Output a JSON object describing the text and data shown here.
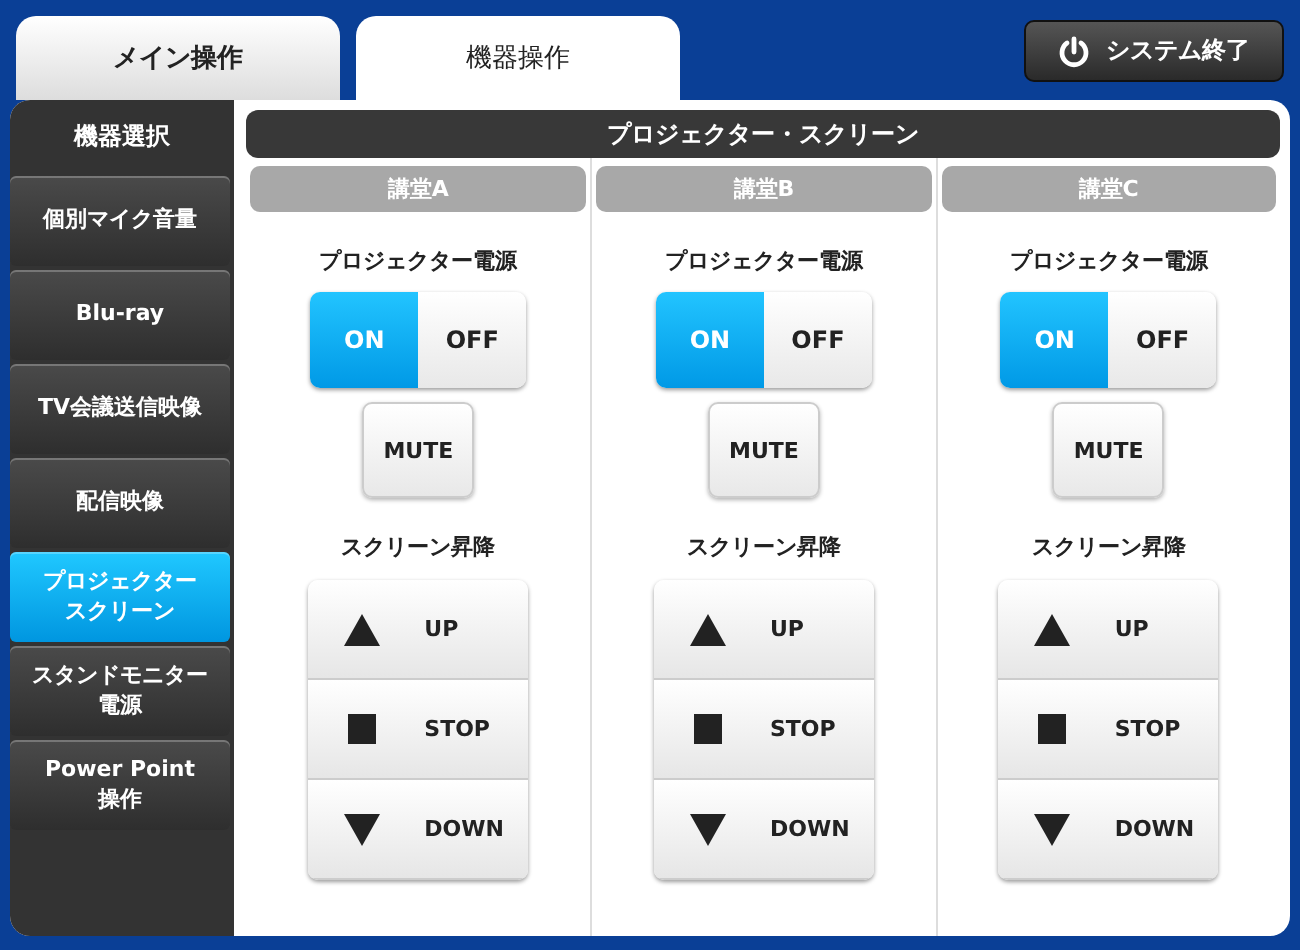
{
  "tabs": [
    {
      "label": "メイン操作",
      "selected": false
    },
    {
      "label": "機器操作",
      "selected": true
    }
  ],
  "system_button": {
    "label": "システム終了"
  },
  "sidebar": {
    "title": "機器選択",
    "items": [
      {
        "lines": [
          "個別マイク音量"
        ],
        "selected": false
      },
      {
        "lines": [
          "Blu-ray"
        ],
        "selected": false
      },
      {
        "lines": [
          "TV会議送信映像"
        ],
        "selected": false
      },
      {
        "lines": [
          "配信映像"
        ],
        "selected": false
      },
      {
        "lines": [
          "プロジェクター",
          "スクリーン"
        ],
        "selected": true
      },
      {
        "lines": [
          "スタンドモニター",
          "電源"
        ],
        "selected": false
      },
      {
        "lines": [
          "Power Point",
          "操作"
        ],
        "selected": false
      }
    ]
  },
  "panel": {
    "title": "プロジェクター・スクリーン",
    "rooms": [
      {
        "name": "講堂A",
        "power_label": "プロジェクター電源",
        "power": [
          {
            "label": "ON",
            "selected": true
          },
          {
            "label": "OFF",
            "selected": false
          }
        ],
        "mute": "MUTE",
        "screen_label": "スクリーン昇降",
        "screen": [
          {
            "kind": "up",
            "label": "UP"
          },
          {
            "kind": "stop",
            "label": "STOP"
          },
          {
            "kind": "down",
            "label": "DOWN"
          }
        ]
      },
      {
        "name": "講堂B",
        "power_label": "プロジェクター電源",
        "power": [
          {
            "label": "ON",
            "selected": true
          },
          {
            "label": "OFF",
            "selected": false
          }
        ],
        "mute": "MUTE",
        "screen_label": "スクリーン昇降",
        "screen": [
          {
            "kind": "up",
            "label": "UP"
          },
          {
            "kind": "stop",
            "label": "STOP"
          },
          {
            "kind": "down",
            "label": "DOWN"
          }
        ]
      },
      {
        "name": "講堂C",
        "power_label": "プロジェクター電源",
        "power": [
          {
            "label": "ON",
            "selected": true
          },
          {
            "label": "OFF",
            "selected": false
          }
        ],
        "mute": "MUTE",
        "screen_label": "スクリーン昇降",
        "screen": [
          {
            "kind": "up",
            "label": "UP"
          },
          {
            "kind": "stop",
            "label": "STOP"
          },
          {
            "kind": "down",
            "label": "DOWN"
          }
        ]
      }
    ]
  }
}
